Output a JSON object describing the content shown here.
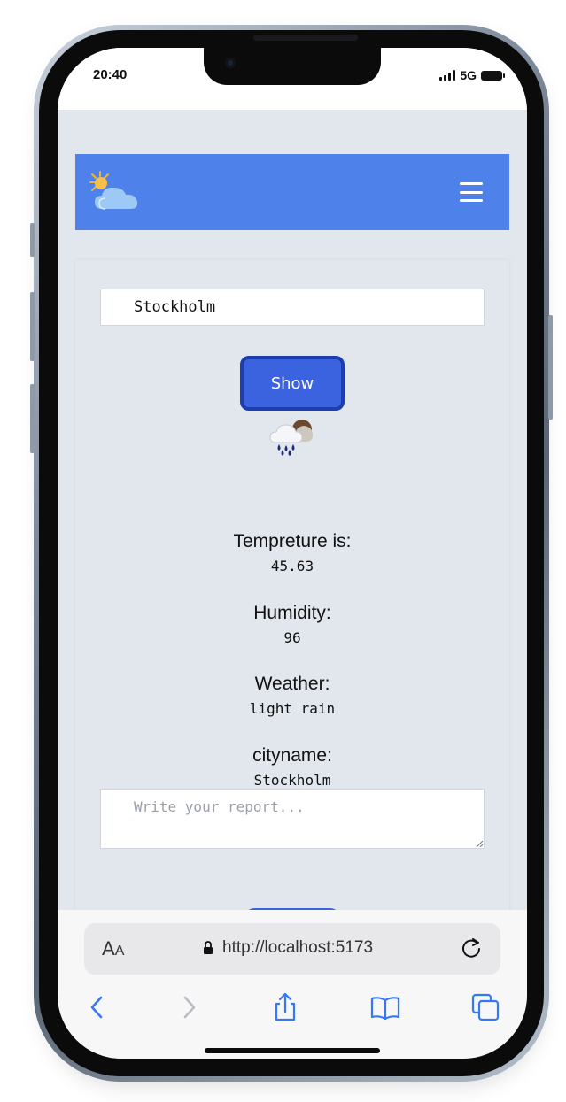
{
  "status_bar": {
    "time": "20:40",
    "network": "5G"
  },
  "navbar": {
    "logo_icon": "sun-behind-cloud-icon",
    "menu_icon": "hamburger-menu-icon",
    "color": "#4e82ea"
  },
  "form": {
    "city_value": "Stockholm",
    "show_label": "Show",
    "button_color": "#3b63e0"
  },
  "weather": {
    "icon": "rain-cloud-icon",
    "temperature_label": "Tempreture is:",
    "temperature_value": "45.63",
    "humidity_label": "Humidity:",
    "humidity_value": "96",
    "weather_label": "Weather:",
    "weather_value": "light rain",
    "cityname_label": "cityname:",
    "cityname_value": "Stockholm"
  },
  "report": {
    "placeholder": "Write your report..."
  },
  "browser": {
    "text_size_label": "A",
    "text_size_label_small": "A",
    "url": "http://localhost:5173",
    "toolbar_icons": [
      "back-icon",
      "forward-icon",
      "share-icon",
      "bookmarks-icon",
      "tabs-icon"
    ]
  }
}
